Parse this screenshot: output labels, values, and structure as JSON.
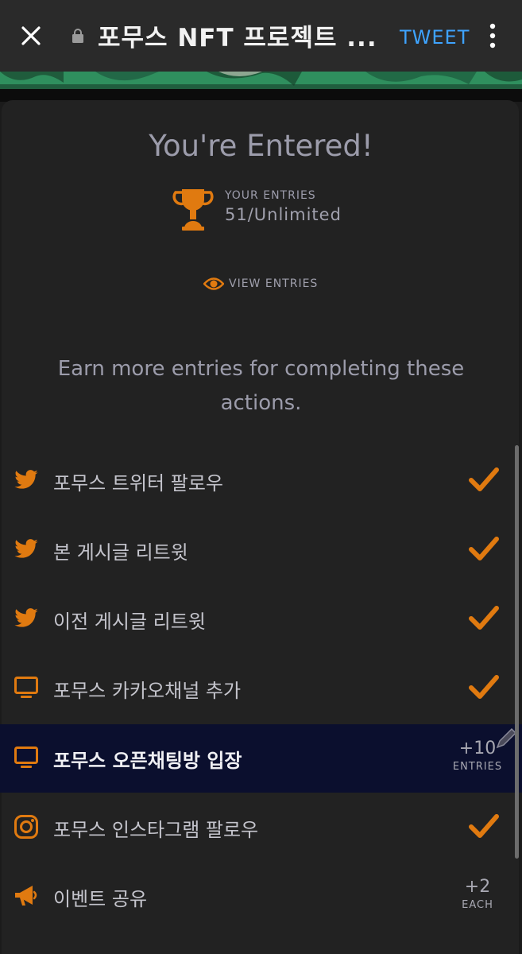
{
  "browser": {
    "title": "포무스 NFT 프로젝트 ...",
    "tweet_label": "TWEET"
  },
  "card": {
    "title": "You're Entered!",
    "your_entries_label": "YOUR ENTRIES",
    "entries_count": "51/Unlimited",
    "view_entries_label": "VIEW ENTRIES",
    "earn_text": "Earn more entries for completing these actions."
  },
  "actions": [
    {
      "label": "포무스 트위터 팔로우",
      "icon": "twitter-icon",
      "status": "done"
    },
    {
      "label": "본 게시글 리트윗",
      "icon": "twitter-icon",
      "status": "done"
    },
    {
      "label": "이전 게시글 리트윗",
      "icon": "twitter-icon",
      "status": "done"
    },
    {
      "label": "포무스 카카오채널 추가",
      "icon": "monitor-icon",
      "status": "done"
    },
    {
      "label": "포무스 오픈채팅방 입장",
      "icon": "monitor-icon",
      "status": "pending",
      "bonus": "+10",
      "bonus_unit": "ENTRIES"
    },
    {
      "label": "포무스 인스타그램 팔로우",
      "icon": "instagram-icon",
      "status": "done"
    },
    {
      "label": "이벤트 공유",
      "icon": "megaphone-icon",
      "status": "pending",
      "bonus": "+2",
      "bonus_unit": "EACH"
    }
  ],
  "colors": {
    "accent": "#e07a10",
    "highlight_row": "#0b0f2e",
    "link": "#3ea3ff"
  }
}
